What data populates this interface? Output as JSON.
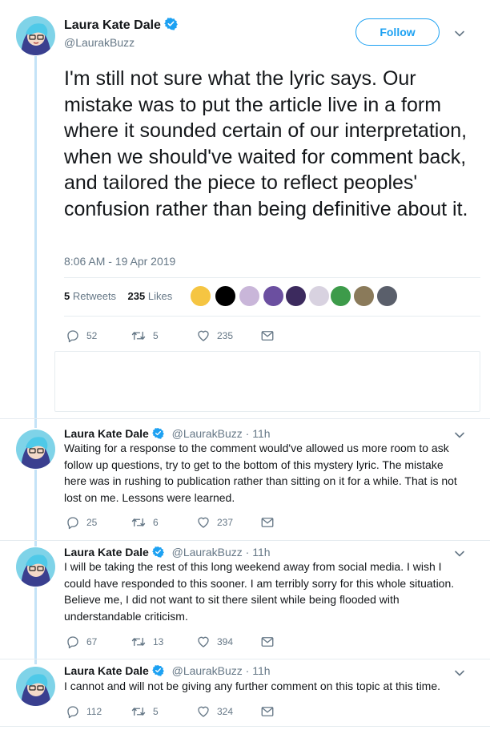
{
  "main": {
    "name": "Laura Kate Dale",
    "handle": "@LaurakBuzz",
    "follow_label": "Follow",
    "text": "I'm still not sure what the lyric says. Our mistake was to put the article live in a form where it sounded certain of our interpretation, when we should've waited for comment back, and  tailored the piece to reflect peoples' confusion rather than being definitive about it.",
    "timestamp": "8:06 AM - 19 Apr 2019",
    "retweets_count": "5",
    "retweets_label": "Retweets",
    "likes_count": "235",
    "likes_label": "Likes",
    "actions": {
      "replies": "52",
      "retweets": "5",
      "likes": "235"
    }
  },
  "replies": [
    {
      "name": "Laura Kate Dale",
      "handle": "@LaurakBuzz · 11h",
      "text": "Waiting for a response to the comment would've allowed us more room to ask follow up questions, try to get to the bottom of this mystery lyric. The mistake here was in rushing to publication rather than sitting on it for a while. That is not lost on me. Lessons were learned.",
      "replies": "25",
      "retweets": "6",
      "likes": "237"
    },
    {
      "name": "Laura Kate Dale",
      "handle": "@LaurakBuzz · 11h",
      "text": "I will be taking the rest of this long weekend away from social media. I wish I could have responded to this sooner. I am terribly sorry for this whole situation. Believe me, I did not want to sit there silent while being flooded with understandable criticism.",
      "replies": "67",
      "retweets": "13",
      "likes": "394"
    },
    {
      "name": "Laura Kate Dale",
      "handle": "@LaurakBuzz · 11h",
      "text": "I cannot and will not be giving any further comment on this topic at this time.",
      "replies": "112",
      "retweets": "5",
      "likes": "324"
    }
  ],
  "colors": {
    "accent": "#1da1f2",
    "muted": "#657786",
    "thread_line": "#c4e3f7",
    "divider": "#e6ecf0"
  },
  "icons": [
    "verified-badge-icon",
    "chevron-down-icon",
    "reply-icon",
    "retweet-icon",
    "like-icon",
    "direct-message-icon"
  ]
}
